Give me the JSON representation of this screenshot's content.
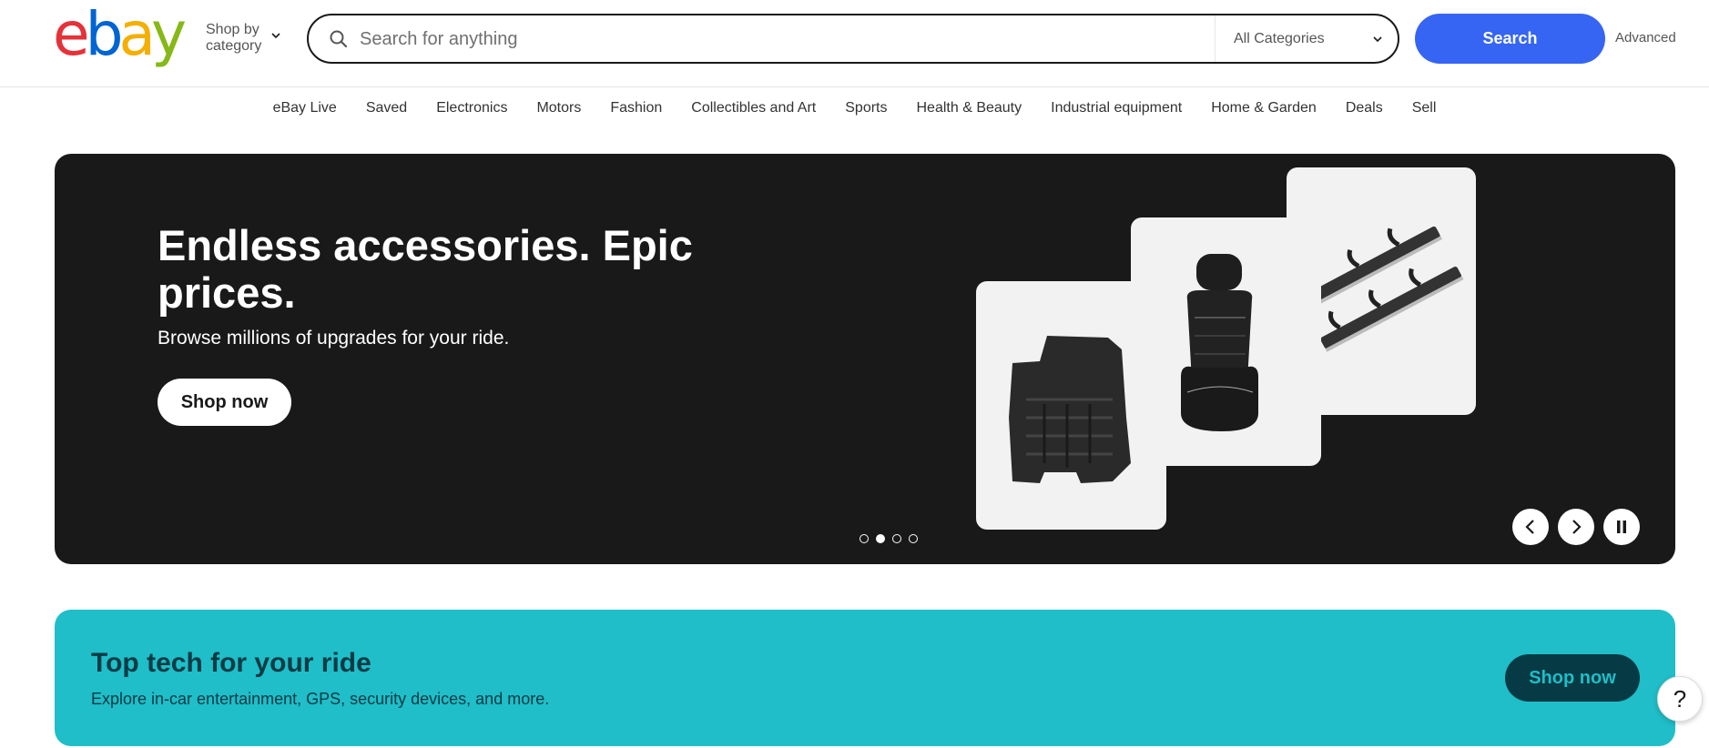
{
  "header": {
    "logo_letters": [
      {
        "char": "e",
        "color": "#e53238"
      },
      {
        "char": "b",
        "color": "#0064d2"
      },
      {
        "char": "a",
        "color": "#f5af02"
      },
      {
        "char": "y",
        "color": "#86b817"
      }
    ],
    "shop_by_category_line1": "Shop by",
    "shop_by_category_line2": "category",
    "search_placeholder": "Search for anything",
    "category_select": "All Categories",
    "search_button": "Search",
    "advanced_link": "Advanced"
  },
  "nav": {
    "items": [
      "eBay Live",
      "Saved",
      "Electronics",
      "Motors",
      "Fashion",
      "Collectibles and Art",
      "Sports",
      "Health & Beauty",
      "Industrial equipment",
      "Home & Garden",
      "Deals",
      "Sell"
    ]
  },
  "hero": {
    "title": "Endless accessories. Epic prices.",
    "subtitle": "Browse millions of upgrades for your ride.",
    "cta": "Shop now",
    "slide_count": 4,
    "active_slide": 2
  },
  "banner2": {
    "title": "Top tech for your ride",
    "subtitle": "Explore in-car entertainment, GPS, security devices, and more.",
    "cta": "Shop now"
  },
  "help": {
    "label": "?"
  },
  "colors": {
    "accent": "#3665f3",
    "hero_bg": "#191919",
    "banner_bg": "#1fbec8",
    "banner_text": "#063b45"
  }
}
